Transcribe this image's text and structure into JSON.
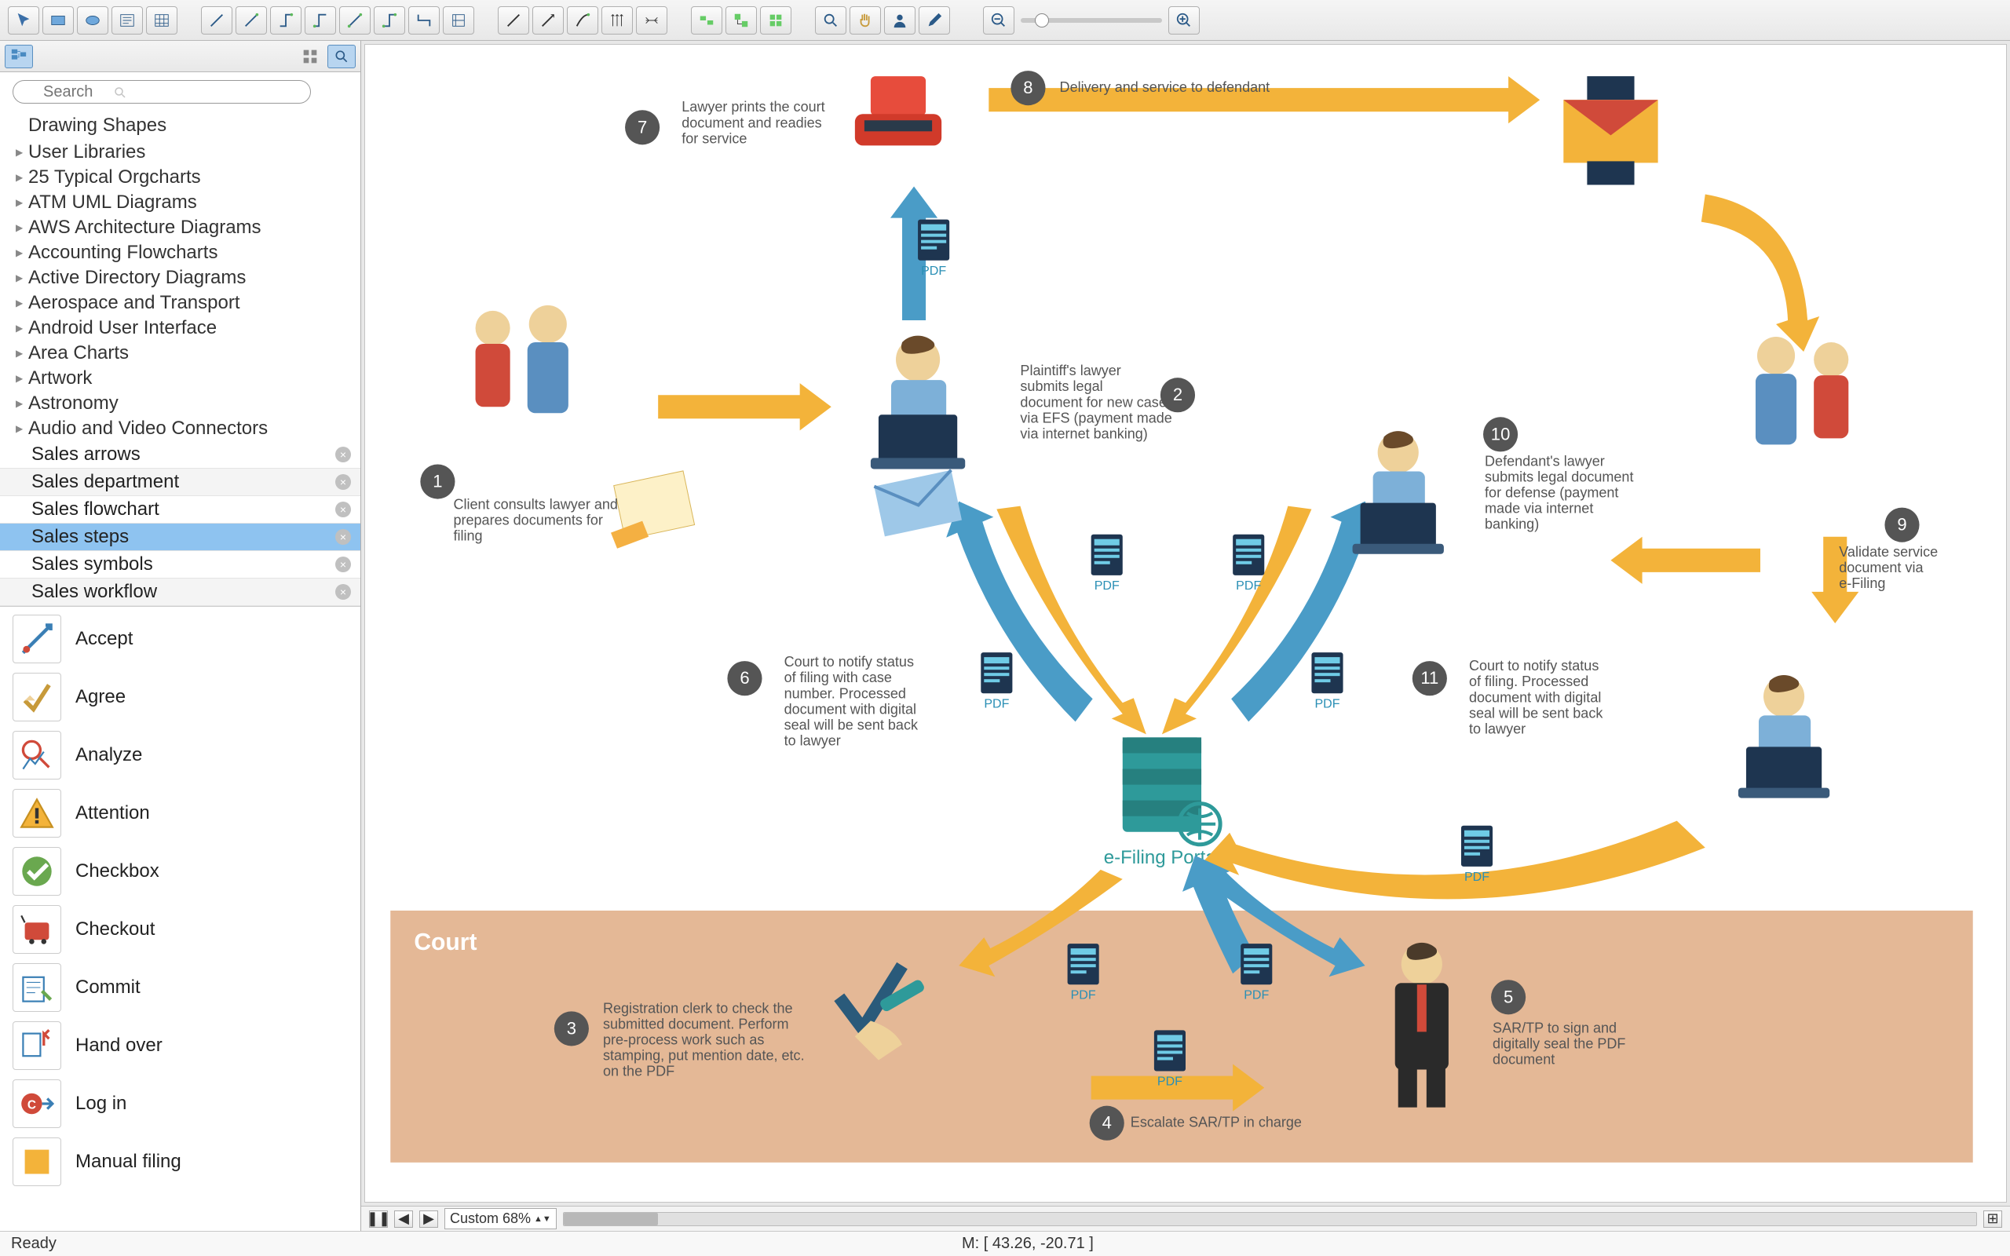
{
  "toolbar": {
    "buttons_group1": [
      "selection-tool",
      "rectangle-tool",
      "ellipse-tool",
      "text-tool",
      "table-tool"
    ],
    "buttons_group2": [
      "connector-1",
      "connector-2",
      "connector-3",
      "connector-4",
      "connector-5",
      "connector-6",
      "connector-7",
      "connector-8"
    ],
    "buttons_group3": [
      "line-1",
      "line-2",
      "line-3",
      "line-4",
      "line-5"
    ],
    "buttons_group4": [
      "align-1",
      "align-2",
      "align-3"
    ],
    "buttons_group5": [
      "zoom-tool",
      "pan-tool",
      "user-tool",
      "color-picker"
    ]
  },
  "sidebar": {
    "search_placeholder": "Search",
    "drawing_shapes": "Drawing Shapes",
    "libraries": [
      "User Libraries",
      "25 Typical Orgcharts",
      "ATM UML Diagrams",
      "AWS Architecture Diagrams",
      "Accounting Flowcharts",
      "Active Directory Diagrams",
      "Aerospace and Transport",
      "Android User Interface",
      "Area Charts",
      "Artwork",
      "Astronomy",
      "Audio and Video Connectors"
    ],
    "tabs": [
      {
        "label": "Sales arrows"
      },
      {
        "label": "Sales department"
      },
      {
        "label": "Sales flowchart"
      },
      {
        "label": "Sales steps",
        "selected": true
      },
      {
        "label": "Sales symbols"
      },
      {
        "label": "Sales workflow"
      }
    ],
    "shapes": [
      {
        "label": "Accept"
      },
      {
        "label": "Agree"
      },
      {
        "label": "Analyze"
      },
      {
        "label": "Attention"
      },
      {
        "label": "Checkbox"
      },
      {
        "label": "Checkout"
      },
      {
        "label": "Commit"
      },
      {
        "label": "Hand over"
      },
      {
        "label": "Log in"
      },
      {
        "label": "Manual filing"
      }
    ]
  },
  "diagram": {
    "portal_label": "e-Filing Portal",
    "court_label": "Court",
    "pdf_label": "PDF",
    "steps": {
      "1": "Client consults lawyer and prepares documents for filing",
      "2": "Plaintiff's lawyer submits legal document for new case via EFS (payment made via internet banking)",
      "3": "Registration clerk to check the submitted document. Perform pre-process work such as stamping, put mention date, etc. on the PDF",
      "4": "Escalate SAR/TP in charge",
      "5": "SAR/TP to sign and digitally seal the PDF document",
      "6": "Court to notify status of filing with case number. Processed document with digital seal will be sent back to lawyer",
      "7": "Lawyer prints the court document and readies for service",
      "8": "Delivery and service to defendant",
      "9": "Validate service document via e-Filing",
      "10": "Defendant's lawyer submits legal document for defense (payment made via internet banking)",
      "11": "Court to notify status of filing. Processed document with digital seal will be sent back to lawyer"
    }
  },
  "bottombar": {
    "zoom_label": "Custom 68%"
  },
  "statusbar": {
    "ready": "Ready",
    "mouse": "M: [ 43.26, -20.71 ]"
  }
}
